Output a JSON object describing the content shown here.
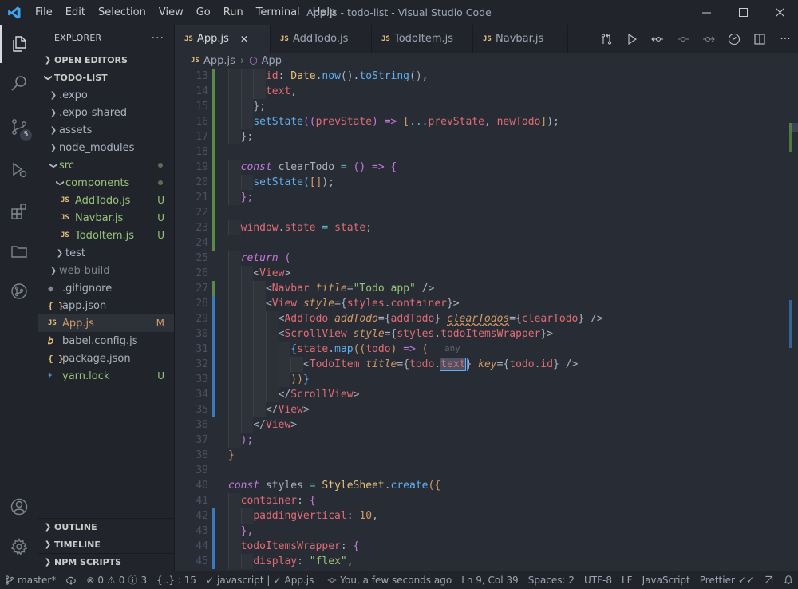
{
  "window": {
    "title": "App.js - todo-list - Visual Studio Code"
  },
  "menu": [
    "File",
    "Edit",
    "Selection",
    "View",
    "Go",
    "Run",
    "Terminal",
    "Help"
  ],
  "activity": {
    "scm_badge": "5"
  },
  "explorer": {
    "header": "EXPLORER",
    "open_editors": "OPEN EDITORS",
    "project": "TODO-LIST",
    "tree": [
      {
        "label": ".expo",
        "kind": "folder",
        "indent": 1
      },
      {
        "label": ".expo-shared",
        "kind": "folder",
        "indent": 1
      },
      {
        "label": "assets",
        "kind": "folder",
        "indent": 1
      },
      {
        "label": "node_modules",
        "kind": "folder",
        "indent": 1
      },
      {
        "label": "src",
        "kind": "folder-open",
        "indent": 1,
        "dot": true
      },
      {
        "label": "components",
        "kind": "folder-open",
        "indent": 2,
        "dot": true
      },
      {
        "label": "AddTodo.js",
        "kind": "js",
        "indent": 3,
        "status": "U"
      },
      {
        "label": "Navbar.js",
        "kind": "js",
        "indent": 3,
        "status": "U"
      },
      {
        "label": "TodoItem.js",
        "kind": "js",
        "indent": 3,
        "status": "U"
      },
      {
        "label": "test",
        "kind": "folder",
        "indent": 2
      },
      {
        "label": "web-build",
        "kind": "folder",
        "indent": 1,
        "dim": true
      },
      {
        "label": ".gitignore",
        "kind": "git",
        "indent": 1
      },
      {
        "label": "app.json",
        "kind": "json",
        "indent": 1
      },
      {
        "label": "App.js",
        "kind": "js",
        "indent": 1,
        "status": "M",
        "selected": true
      },
      {
        "label": "babel.config.js",
        "kind": "babel",
        "indent": 1
      },
      {
        "label": "package.json",
        "kind": "json",
        "indent": 1
      },
      {
        "label": "yarn.lock",
        "kind": "yarn",
        "indent": 1,
        "status": "U"
      }
    ],
    "bottom_sections": [
      "OUTLINE",
      "TIMELINE",
      "NPM SCRIPTS"
    ]
  },
  "tabs": [
    {
      "label": "App.js",
      "active": true
    },
    {
      "label": "AddTodo.js"
    },
    {
      "label": "TodoItem.js"
    },
    {
      "label": "Navbar.js"
    }
  ],
  "breadcrumb": {
    "file": "App.js",
    "symbol": "App"
  },
  "code_lines": [
    {
      "n": "13",
      "g": "add",
      "d": 3,
      "t": [
        [
          "id",
          "pr"
        ],
        [
          ": ",
          "pu"
        ],
        [
          "Date",
          "ty"
        ],
        [
          ".",
          "pu"
        ],
        [
          "now",
          "fn"
        ],
        [
          "().",
          "pu"
        ],
        [
          "toString",
          "fn"
        ],
        [
          "(),",
          "pu"
        ]
      ]
    },
    {
      "n": "14",
      "g": "add",
      "d": 3,
      "t": [
        [
          "text",
          "pr"
        ],
        [
          ",",
          "pu"
        ]
      ]
    },
    {
      "n": "15",
      "g": "add",
      "d": 2,
      "t": [
        [
          "};",
          "pu"
        ]
      ]
    },
    {
      "n": "16",
      "g": "add",
      "d": 2,
      "t": [
        [
          "setState",
          "fn"
        ],
        [
          "((",
          "g2"
        ],
        [
          "prevState",
          "vr"
        ],
        [
          ") ",
          "g2"
        ],
        [
          "=>",
          "kw"
        ],
        [
          " [",
          "g1"
        ],
        [
          "...",
          "op"
        ],
        [
          "prevState",
          "vr"
        ],
        [
          ", ",
          "pu"
        ],
        [
          "newTodo",
          "vr"
        ],
        [
          "]",
          "g1"
        ],
        [
          ");",
          "pu"
        ]
      ]
    },
    {
      "n": "17",
      "g": "add",
      "d": 1,
      "t": [
        [
          "};",
          "pu"
        ]
      ]
    },
    {
      "n": "18",
      "g": "add",
      "d": 0,
      "t": []
    },
    {
      "n": "19",
      "g": "add",
      "d": 1,
      "t": [
        [
          "const",
          "kwi"
        ],
        [
          " clearTodo ",
          "pu"
        ],
        [
          "=",
          "op"
        ],
        [
          " () ",
          "g2"
        ],
        [
          "=>",
          "kw"
        ],
        [
          " {",
          "g2"
        ]
      ]
    },
    {
      "n": "20",
      "g": "add",
      "d": 2,
      "t": [
        [
          "setState",
          "fn"
        ],
        [
          "(",
          "g3"
        ],
        [
          "[]",
          "g1"
        ],
        [
          ");",
          "pu"
        ]
      ]
    },
    {
      "n": "21",
      "g": "add",
      "d": 1,
      "t": [
        [
          "};",
          "g2"
        ]
      ]
    },
    {
      "n": "22",
      "g": "add",
      "d": 0,
      "t": []
    },
    {
      "n": "23",
      "g": "add",
      "d": 1,
      "t": [
        [
          "window",
          "vr"
        ],
        [
          ".",
          "pu"
        ],
        [
          "state",
          "vr"
        ],
        [
          " = ",
          "op"
        ],
        [
          "state",
          "vr"
        ],
        [
          ";",
          "pu"
        ]
      ]
    },
    {
      "n": "24",
      "g": "add",
      "d": 0,
      "t": []
    },
    {
      "n": "25",
      "g": "",
      "d": 1,
      "t": [
        [
          "return",
          "kwi"
        ],
        [
          " (",
          "g2"
        ]
      ]
    },
    {
      "n": "26",
      "g": "",
      "d": 2,
      "t": [
        [
          "<",
          "pu"
        ],
        [
          "View",
          "tg"
        ],
        [
          ">",
          "pu"
        ]
      ]
    },
    {
      "n": "27",
      "g": "add",
      "d": 3,
      "t": [
        [
          "<",
          "pu"
        ],
        [
          "Navbar",
          "tg"
        ],
        [
          " title",
          "at"
        ],
        [
          "=",
          "pu"
        ],
        [
          "\"Todo app\"",
          "st"
        ],
        [
          " />",
          "pu"
        ]
      ]
    },
    {
      "n": "28",
      "g": "mod",
      "d": 3,
      "t": [
        [
          "<",
          "pu"
        ],
        [
          "View",
          "tg"
        ],
        [
          " style",
          "at"
        ],
        [
          "={",
          "pu"
        ],
        [
          "styles",
          "vr"
        ],
        [
          ".",
          "pu"
        ],
        [
          "container",
          "vr"
        ],
        [
          "}>",
          "pu"
        ]
      ]
    },
    {
      "n": "29",
      "g": "mod",
      "d": 4,
      "t": [
        [
          "<",
          "pu"
        ],
        [
          "AddTodo",
          "tg"
        ],
        [
          " addTodo",
          "at"
        ],
        [
          "={",
          "pu"
        ],
        [
          "addTodo",
          "vr"
        ],
        [
          "} ",
          "pu"
        ],
        [
          "clearTodos",
          "at err"
        ],
        [
          "={",
          "pu"
        ],
        [
          "clearTodo",
          "vr"
        ],
        [
          "} />",
          "pu"
        ]
      ]
    },
    {
      "n": "30",
      "g": "mod",
      "d": 4,
      "t": [
        [
          "<",
          "pu"
        ],
        [
          "ScrollView",
          "tg"
        ],
        [
          " style",
          "at"
        ],
        [
          "={",
          "pu"
        ],
        [
          "styles",
          "vr"
        ],
        [
          ".",
          "pu"
        ],
        [
          "todoItemsWrapper",
          "vr"
        ],
        [
          "}>",
          "pu"
        ]
      ]
    },
    {
      "n": "31",
      "g": "mod",
      "d": 5,
      "t": [
        [
          "{",
          "g3"
        ],
        [
          "state",
          "vr"
        ],
        [
          ".",
          "pu"
        ],
        [
          "map",
          "fn"
        ],
        [
          "((",
          "g1"
        ],
        [
          "todo",
          "vr"
        ],
        [
          ") ",
          "g1"
        ],
        [
          "=>",
          "kw"
        ],
        [
          " (",
          "g1"
        ]
      ]
    },
    {
      "n": "32",
      "g": "mod",
      "d": 6,
      "t": [
        [
          "<",
          "pu"
        ],
        [
          "TodoItem",
          "tg"
        ],
        [
          " title",
          "at"
        ],
        [
          "={",
          "pu"
        ],
        [
          "todo",
          "vr"
        ],
        [
          ".",
          "pu"
        ],
        [
          "text",
          "vr hlword"
        ],
        [
          "}",
          "pu"
        ],
        [
          " key",
          "at"
        ],
        [
          "={",
          "pu"
        ],
        [
          "todo",
          "vr"
        ],
        [
          ".",
          "pu"
        ],
        [
          "id",
          "vr"
        ],
        [
          "} />",
          "pu"
        ]
      ]
    },
    {
      "n": "33",
      "g": "mod",
      "d": 5,
      "t": [
        [
          "))",
          "g1"
        ],
        [
          "}",
          "g3"
        ]
      ]
    },
    {
      "n": "34",
      "g": "mod",
      "d": 4,
      "t": [
        [
          "</",
          "pu"
        ],
        [
          "ScrollView",
          "tg"
        ],
        [
          ">",
          "pu"
        ]
      ]
    },
    {
      "n": "35",
      "g": "mod",
      "d": 3,
      "t": [
        [
          "</",
          "pu"
        ],
        [
          "View",
          "tg"
        ],
        [
          ">",
          "pu"
        ]
      ]
    },
    {
      "n": "36",
      "g": "",
      "d": 2,
      "t": [
        [
          "</",
          "pu"
        ],
        [
          "View",
          "tg"
        ],
        [
          ">",
          "pu"
        ]
      ]
    },
    {
      "n": "37",
      "g": "",
      "d": 1,
      "t": [
        [
          ");",
          "g2"
        ]
      ]
    },
    {
      "n": "38",
      "g": "",
      "d": 0,
      "t": [
        [
          "}",
          "g1"
        ]
      ]
    },
    {
      "n": "39",
      "g": "",
      "d": 0,
      "t": []
    },
    {
      "n": "40",
      "g": "",
      "d": 0,
      "t": [
        [
          "const",
          "kwi"
        ],
        [
          " styles ",
          "pu"
        ],
        [
          "=",
          "op"
        ],
        [
          " ",
          "pu"
        ],
        [
          "StyleSheet",
          "ty"
        ],
        [
          ".",
          "pu"
        ],
        [
          "create",
          "fn"
        ],
        [
          "({",
          "g1"
        ]
      ]
    },
    {
      "n": "41",
      "g": "",
      "d": 1,
      "t": [
        [
          "container",
          "pr"
        ],
        [
          ": ",
          "pu"
        ],
        [
          "{",
          "g2"
        ]
      ]
    },
    {
      "n": "42",
      "g": "mod",
      "d": 2,
      "t": [
        [
          "paddingVertical",
          "pr"
        ],
        [
          ": ",
          "pu"
        ],
        [
          "10",
          "nm"
        ],
        [
          ",",
          "pu"
        ]
      ]
    },
    {
      "n": "43",
      "g": "mod",
      "d": 1,
      "t": [
        [
          "},",
          "g2"
        ]
      ]
    },
    {
      "n": "44",
      "g": "mod",
      "d": 1,
      "t": [
        [
          "todoItemsWrapper",
          "pr"
        ],
        [
          ": ",
          "pu"
        ],
        [
          "{",
          "g2"
        ]
      ]
    },
    {
      "n": "45",
      "g": "mod",
      "d": 2,
      "t": [
        [
          "display",
          "pr"
        ],
        [
          ": ",
          "pu"
        ],
        [
          "\"flex\"",
          "st"
        ],
        [
          ",",
          "pu"
        ]
      ]
    }
  ],
  "ghost_hint": "any",
  "statusbar": {
    "branch": "master*",
    "errors": "0",
    "warnings": "0",
    "info": "3",
    "selection": "{..} : 15",
    "language_ctx": "javascript | ",
    "file_ctx": "App.js",
    "blame": "You, a few seconds ago",
    "position": "Ln 9, Col 39",
    "spaces": "Spaces: 2",
    "encoding": "UTF-8",
    "eol": "LF",
    "language": "JavaScript",
    "formatter": "Prettier"
  }
}
